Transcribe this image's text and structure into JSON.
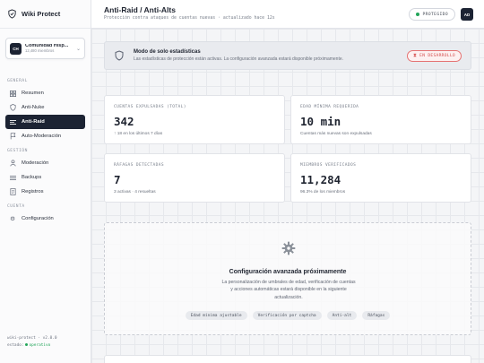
{
  "app": {
    "name": "Wiki Protect"
  },
  "server": {
    "initials": "CH",
    "name": "Comunidad Hisp...",
    "members": "12,480 miembros"
  },
  "sidebar": {
    "sections": {
      "general": "GENERAL",
      "gestion": "GESTIÓN",
      "cuenta": "CUENTA"
    },
    "items": [
      {
        "label": "Resumen",
        "icon": "grid-icon"
      },
      {
        "label": "Anti-Nuke",
        "icon": "shield-icon"
      },
      {
        "label": "Anti-Raid",
        "icon": "list-icon",
        "active": true
      },
      {
        "label": "Auto-Moderación",
        "icon": "flag-icon"
      },
      {
        "label": "Moderación",
        "icon": "user-icon"
      },
      {
        "label": "Backups",
        "icon": "stack-icon"
      },
      {
        "label": "Registros",
        "icon": "file-icon"
      },
      {
        "label": "Configuración",
        "icon": "gear-icon"
      }
    ],
    "footer": {
      "version": "wiki-protect · v2.0.0",
      "status_label": "estado:",
      "status_value": "operativo"
    }
  },
  "header": {
    "title": "Anti-Raid / Anti-Alts",
    "subtitle": "Protección contra ataques de cuentas nuevas · actualizado hace 12s",
    "status_pill": "PROTEGIDO",
    "user_initials": "AD"
  },
  "notice": {
    "title": "Modo de solo estadísticas",
    "text": "Las estadísticas de protección están activas. La configuración avanzada estará disponible próximamente.",
    "badge": "EN DESARROLLO"
  },
  "stats": [
    {
      "label": "CUENTAS EXPULSADAS (TOTAL)",
      "value": "342",
      "hint": "↑ 18 en los últimos 7 días"
    },
    {
      "label": "EDAD MÍNIMA REQUERIDA",
      "value": "10 min",
      "hint": "Cuentas más nuevas son expulsadas"
    },
    {
      "label": "RÁFAGAS DETECTADAS",
      "value": "7",
      "hint": "3 activas · 4 resueltas"
    },
    {
      "label": "MIEMBROS VERIFICADOS",
      "value": "11,284",
      "hint": "96.3% de los miembros"
    }
  ],
  "coming_soon": {
    "title": "Configuración avanzada próximamente",
    "text": "La personalización de umbrales de edad, verificación de cuentas y acciones automáticas estará disponible en la siguiente actualización.",
    "chips": [
      "Edad mínima ajustable",
      "Verificación por captcha",
      "Anti-alt",
      "Ráfagas"
    ]
  },
  "colors": {
    "accent": "#1c2333",
    "success": "#23a55a",
    "warning": "#d44c4c"
  }
}
